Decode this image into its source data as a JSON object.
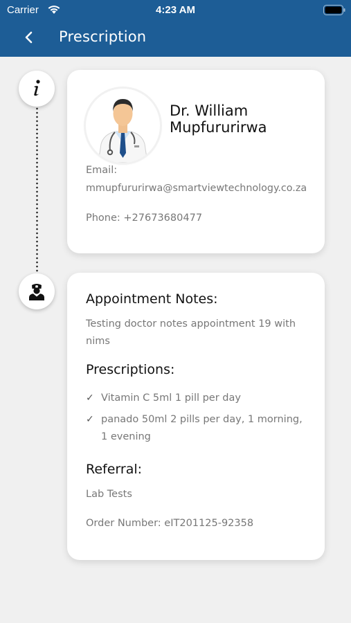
{
  "status_bar": {
    "carrier": "Carrier",
    "time": "4:23 AM"
  },
  "header": {
    "title": "Prescription",
    "background": "#1d5d96"
  },
  "timeline": {
    "icons": [
      "info-icon",
      "nurse-icon"
    ]
  },
  "doctor": {
    "name": "Dr. William Mupfururirwa",
    "email_label": "Email:",
    "email": "mmupfururirwa@smartviewtechnology.co.za",
    "phone": "Phone: +27673680477"
  },
  "appointment": {
    "notes_title": "Appointment Notes:",
    "notes": "Testing doctor notes appointment 19 with nims",
    "prescriptions_title": "Prescriptions:",
    "prescriptions": [
      "Vitamin C 5ml 1 pill per day",
      "panado 50ml 2 pills per day, 1 morning, 1 evening"
    ],
    "referral_title": "Referral:",
    "referral": "Lab Tests",
    "order_number": "Order Number: eIT201125-92358"
  }
}
